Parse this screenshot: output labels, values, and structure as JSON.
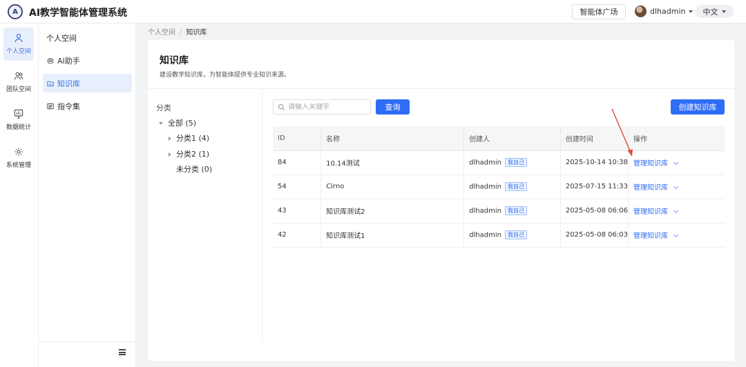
{
  "header": {
    "logo_text": "A",
    "title": "AI教学智能体管理系统",
    "plaza_button": "智能体广场",
    "username": "dlhadmin",
    "language": "中文"
  },
  "rail": {
    "items": [
      {
        "label": "个人空间",
        "icon": "person-icon",
        "active": true
      },
      {
        "label": "团队空间",
        "icon": "team-icon"
      },
      {
        "label": "数据统计",
        "icon": "chart-icon"
      },
      {
        "label": "系统管理",
        "icon": "gear-icon"
      }
    ]
  },
  "sidebar": {
    "heading": "个人空间",
    "items": [
      {
        "label": "AI助手",
        "icon": "robot-icon"
      },
      {
        "label": "知识库",
        "icon": "folder-icon",
        "active": true
      },
      {
        "label": "指令集",
        "icon": "command-icon"
      }
    ]
  },
  "breadcrumb": {
    "parent": "个人空间",
    "current": "知识库",
    "separator": "/"
  },
  "page": {
    "title": "知识库",
    "description": "建设教学知识库，为智能体提供专业知识来源。"
  },
  "tree": {
    "heading": "分类",
    "root": "全部 (5)",
    "children": [
      "分类1 (4)",
      "分类2 (1)"
    ],
    "uncategorized": "未分类 (0)"
  },
  "search": {
    "placeholder": "请输入关键字",
    "query_button": "查询"
  },
  "create_button": "创建知识库",
  "table": {
    "columns": [
      "ID",
      "名称",
      "创建人",
      "创建时间",
      "操作"
    ],
    "self_tag": "我自己",
    "action_label": "管理知识库",
    "rows": [
      {
        "id": "84",
        "name": "10.14测试",
        "creator": "dlhadmin",
        "created": "2025-10-14 10:38"
      },
      {
        "id": "54",
        "name": "Cirno",
        "creator": "dlhadmin",
        "created": "2025-07-15 11:33"
      },
      {
        "id": "43",
        "name": "知识库测试2",
        "creator": "dlhadmin",
        "created": "2025-05-08 06:06"
      },
      {
        "id": "42",
        "name": "知识库测试1",
        "creator": "dlhadmin",
        "created": "2025-05-08 06:03"
      }
    ]
  },
  "colors": {
    "primary": "#2f6df6",
    "active_bg": "#e8effc",
    "annotation_arrow": "#e8463a"
  }
}
